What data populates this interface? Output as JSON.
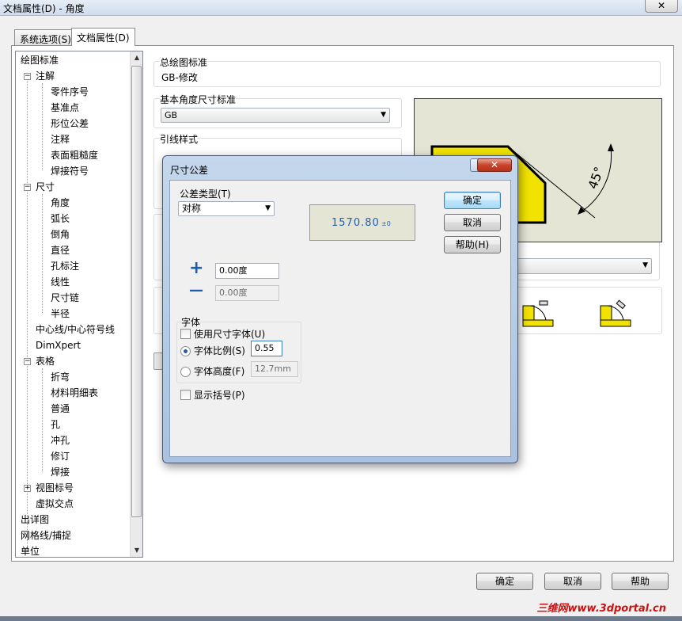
{
  "window": {
    "title": "文档属性(D) - 角度",
    "close_label": "✕"
  },
  "tabs": [
    {
      "label": "系统选项(S)"
    },
    {
      "label": "文档属性(D)"
    }
  ],
  "tree": {
    "items": [
      {
        "label": "绘图标准"
      },
      {
        "label": "注解"
      },
      {
        "label": "零件序号"
      },
      {
        "label": "基准点"
      },
      {
        "label": "形位公差"
      },
      {
        "label": "注释"
      },
      {
        "label": "表面粗糙度"
      },
      {
        "label": "焊接符号"
      },
      {
        "label": "尺寸"
      },
      {
        "label": "角度"
      },
      {
        "label": "弧长"
      },
      {
        "label": "倒角"
      },
      {
        "label": "直径"
      },
      {
        "label": "孔标注"
      },
      {
        "label": "线性"
      },
      {
        "label": "尺寸链"
      },
      {
        "label": "半径"
      },
      {
        "label": "中心线/中心符号线"
      },
      {
        "label": "DimXpert"
      },
      {
        "label": "表格"
      },
      {
        "label": "折弯"
      },
      {
        "label": "材料明细表"
      },
      {
        "label": "普通"
      },
      {
        "label": "孔"
      },
      {
        "label": "冲孔"
      },
      {
        "label": "修订"
      },
      {
        "label": "焊接"
      },
      {
        "label": "视图标号"
      },
      {
        "label": "虚拟交点"
      },
      {
        "label": "出详图"
      },
      {
        "label": "网格线/捕捉"
      },
      {
        "label": "单位"
      }
    ]
  },
  "overall_standard": {
    "label": "总绘图标准",
    "value": "GB-修改"
  },
  "base_angle_standard": {
    "label": "基本角度尺寸标准",
    "value": "GB"
  },
  "leader_style": {
    "label": "引线样式"
  },
  "preview": {
    "angle_label": "45°"
  },
  "dialog": {
    "title": "尺寸公差",
    "help_glyph": "?",
    "close_glyph": "✕",
    "tolerance_type_label": "公差类型(T)",
    "tolerance_type_value": "对称",
    "preview_text": "1570.80",
    "preview_suffix": "±0",
    "ok_label": "确定",
    "cancel_label": "取消",
    "help_label": "帮助(H)",
    "plus_glyph": "+",
    "minus_glyph": "—",
    "upper_value": "0.00度",
    "lower_value": "0.00度",
    "font_group_label": "字体",
    "use_dim_font_label": "使用尺寸字体(U)",
    "use_dim_font_checked": false,
    "font_scale_label": "字体比例(S)",
    "font_scale_value": "0.55",
    "font_height_label": "字体高度(F)",
    "font_height_value": "12.7mm",
    "font_mode": "scale",
    "show_brackets_label": "显示括号(P)",
    "show_brackets_checked": false
  },
  "buttons": {
    "ok": "确定",
    "cancel": "取消",
    "help": "帮助"
  },
  "watermark": "三维网www.3dportal.cn",
  "colors": {
    "accent_blue": "#1a5fb4",
    "preview_yellow": "#f2e200",
    "preview_bg": "#e5e5d6"
  }
}
